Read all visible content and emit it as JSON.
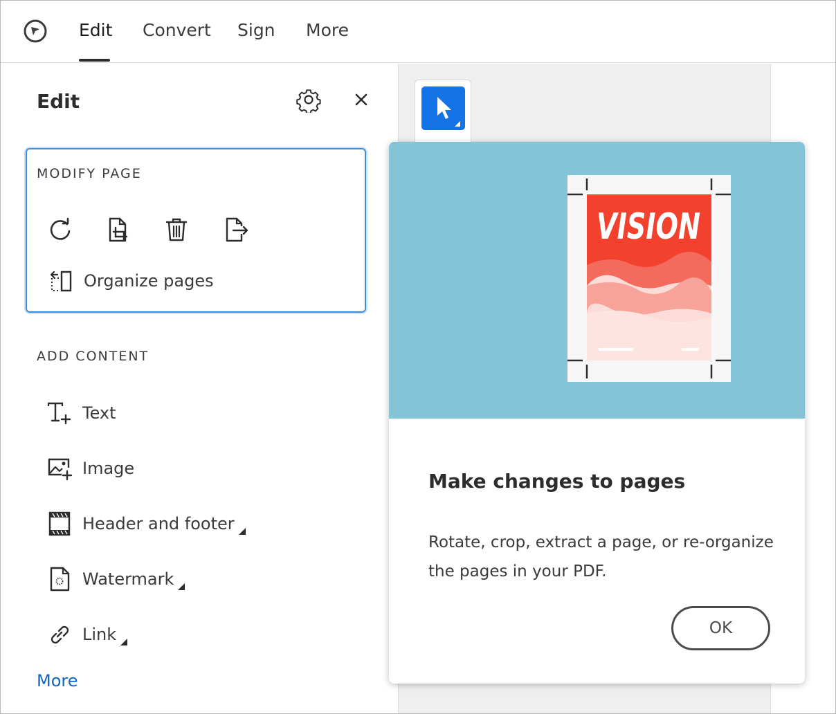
{
  "topbar": {
    "tabs": [
      {
        "label": "Edit"
      },
      {
        "label": "Convert"
      },
      {
        "label": "Sign"
      },
      {
        "label": "More"
      }
    ]
  },
  "panel": {
    "title": "Edit",
    "modify_page": {
      "heading": "MODIFY PAGE",
      "icons": [
        "rotate-icon",
        "crop-page-icon",
        "delete-icon",
        "extract-page-icon"
      ],
      "organize_label": "Organize pages"
    },
    "add_content": {
      "heading": "ADD CONTENT",
      "items": [
        {
          "label": "Text",
          "icon": "add-text-icon"
        },
        {
          "label": "Image",
          "icon": "add-image-icon"
        },
        {
          "label": "Header and footer",
          "icon": "header-footer-icon"
        },
        {
          "label": "Watermark",
          "icon": "watermark-icon"
        },
        {
          "label": "Link",
          "icon": "link-icon"
        }
      ],
      "more_label": "More"
    }
  },
  "coach": {
    "poster_text": "VISION",
    "title": "Make changes to pages",
    "body": "Rotate, crop, extract a page, or re-organize the pages in your PDF.",
    "ok_label": "OK"
  },
  "colors": {
    "accent": "#1473e6",
    "link": "#1266c4",
    "hero_bg": "#84c4d6",
    "focus_ring": "#3a8fd8"
  }
}
